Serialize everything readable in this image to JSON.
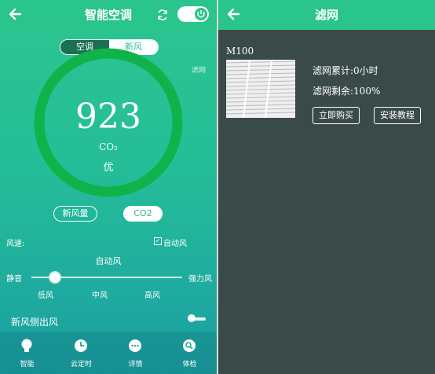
{
  "left_screen": {
    "title": "智能空调",
    "tabs": [
      "空调",
      "新风"
    ],
    "filter_link": "滤网",
    "value": "923",
    "unit": "CO₂",
    "quality": "优",
    "gauge_level": 0.97,
    "metric_buttons": {
      "fresh_air": "新风量",
      "co2": "CO2"
    },
    "fan": {
      "label": "风速:",
      "auto_label": "自动风",
      "auto_checked": true,
      "current_mode": "自动风",
      "min_label": "静音",
      "max_label": "强力风",
      "ticks": [
        "低风",
        "中风",
        "高风"
      ],
      "slider_position": 0.15
    },
    "side_outlet": {
      "label": "新风侧出风",
      "enabled": false
    },
    "bottom_nav": [
      {
        "label": "智能",
        "icon": "lightbulb-icon"
      },
      {
        "label": "云定时",
        "icon": "clock-icon"
      },
      {
        "label": "详情",
        "icon": "more-dots-icon"
      },
      {
        "label": "体检",
        "icon": "checkup-icon"
      }
    ]
  },
  "right_screen": {
    "title": "滤网",
    "model": "M100",
    "usage_text": "滤网累计:0小时",
    "remaining_text": "滤网剩余:100%",
    "buttons": {
      "buy": "立即购买",
      "tutorial": "安装教程"
    }
  },
  "colors": {
    "accent": "#2ac48d",
    "gauge_ring": "#0fb34a",
    "right_bg": "#3a4a48",
    "segment_active": "#1b7052"
  }
}
